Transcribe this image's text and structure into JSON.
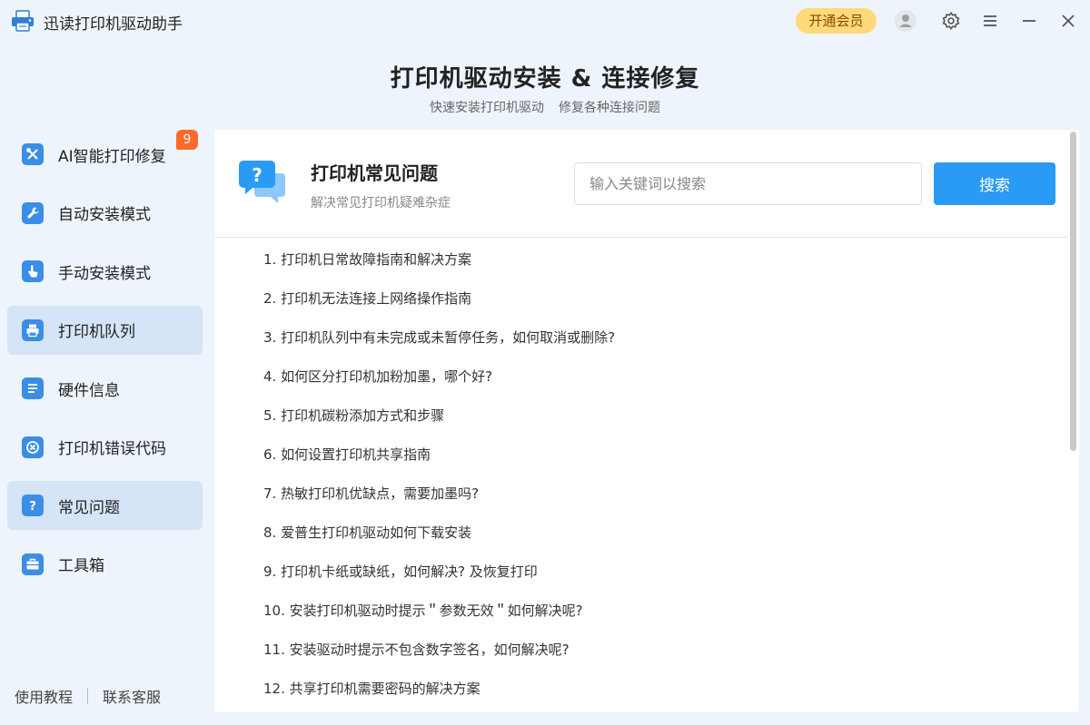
{
  "app": {
    "title": "迅读打印机驱动助手"
  },
  "titlebar": {
    "vip_label": "开通会员"
  },
  "header": {
    "title": "打印机驱动安装 & 连接修复",
    "subtitle_1": "快速安装打印机驱动",
    "subtitle_2": "修复各种连接问题"
  },
  "sidebar": {
    "items": [
      {
        "label": "AI智能打印修复",
        "icon": "wrench-screwdriver-icon",
        "badge": "9"
      },
      {
        "label": "自动安装模式",
        "icon": "wrench-icon"
      },
      {
        "label": "手动安装模式",
        "icon": "hand-pointer-icon"
      },
      {
        "label": "打印机队列",
        "icon": "printer-icon",
        "active": true
      },
      {
        "label": "硬件信息",
        "icon": "list-icon"
      },
      {
        "label": "打印机错误代码",
        "icon": "error-x-icon"
      },
      {
        "label": "常见问题",
        "icon": "question-icon",
        "active": true
      },
      {
        "label": "工具箱",
        "icon": "toolbox-icon"
      }
    ],
    "footer": {
      "tutorial": "使用教程",
      "support": "联系客服"
    }
  },
  "panel": {
    "title": "打印机常见问题",
    "subtitle": "解决常见打印机疑难杂症",
    "search": {
      "placeholder": "输入关键词以搜索",
      "button": "搜索"
    },
    "faq": [
      "1. 打印机日常故障指南和解决方案",
      "2. 打印机无法连接上网络操作指南",
      "3. 打印机队列中有未完成或未暂停任务，如何取消或删除?",
      "4. 如何区分打印机加粉加墨，哪个好?",
      "5. 打印机碳粉添加方式和步骤",
      "6. 如何设置打印机共享指南",
      "7. 热敏打印机优缺点，需要加墨吗?",
      "8. 爱普生打印机驱动如何下载安装",
      "9. 打印机卡纸或缺纸，如何解决? 及恢复打印",
      "10. 安装打印机驱动时提示＂参数无效＂如何解决呢?",
      "11. 安装驱动时提示不包含数字签名，如何解决呢?",
      "12. 共享打印机需要密码的解决方案"
    ]
  },
  "colors": {
    "accent": "#2a9bf4",
    "icon_blue": "#3a8ee6",
    "badge": "#ff6a2a",
    "vip": "#ffd97a",
    "active_bg": "#d6e4f7"
  }
}
